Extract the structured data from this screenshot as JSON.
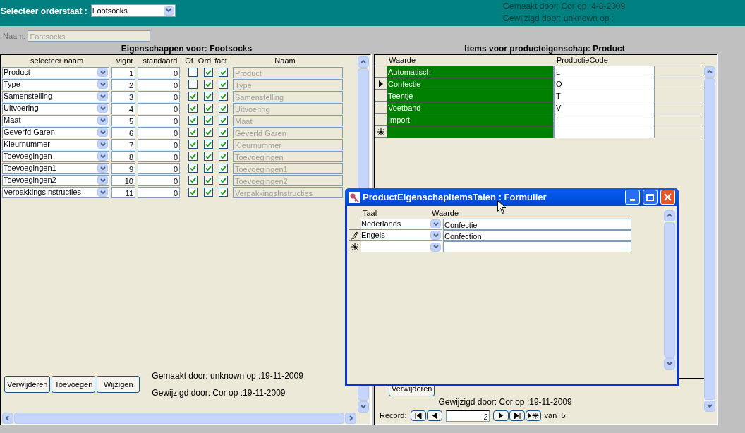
{
  "header": {
    "label": "Selecteer orderstaat :",
    "orderstaat": "Footsocks",
    "created": "Gemaakt door: Cor op :4-8-2009",
    "modified": "Gewijzigd door: unknown op :"
  },
  "name_field": {
    "label": "Naam:",
    "value": "Footsocks",
    "disabled": true
  },
  "properties": {
    "title": "Eigenschappen voor: Footsocks",
    "columns": [
      "selecteer naam",
      "vlgnr",
      "standaard",
      "Of",
      "Ord",
      "fact",
      "Naam"
    ],
    "rows": [
      {
        "name": "Product",
        "vlgnr": "1",
        "standaard": "0",
        "of": false,
        "ord": true,
        "fact": true,
        "naam": "Product"
      },
      {
        "name": "Type",
        "vlgnr": "2",
        "standaard": "0",
        "of": false,
        "ord": true,
        "fact": true,
        "naam": "Type"
      },
      {
        "name": "Samenstelling",
        "vlgnr": "3",
        "standaard": "0",
        "of": true,
        "ord": true,
        "fact": true,
        "naam": "Samenstelling"
      },
      {
        "name": "Uitvoering",
        "vlgnr": "4",
        "standaard": "0",
        "of": true,
        "ord": true,
        "fact": true,
        "naam": "Uitvoering"
      },
      {
        "name": "Maat",
        "vlgnr": "5",
        "standaard": "0",
        "of": true,
        "ord": true,
        "fact": true,
        "naam": "Maat"
      },
      {
        "name": "Geverfd Garen",
        "vlgnr": "6",
        "standaard": "0",
        "of": true,
        "ord": true,
        "fact": true,
        "naam": "Geverfd Garen"
      },
      {
        "name": "Kleurnummer",
        "vlgnr": "7",
        "standaard": "0",
        "of": true,
        "ord": true,
        "fact": true,
        "naam": "Kleurnummer"
      },
      {
        "name": "Toevoegingen",
        "vlgnr": "8",
        "standaard": "0",
        "of": true,
        "ord": true,
        "fact": true,
        "naam": "Toevoegingen"
      },
      {
        "name": "Toevoegingen1",
        "vlgnr": "9",
        "standaard": "0",
        "of": true,
        "ord": true,
        "fact": true,
        "naam": "Toevoegingen1"
      },
      {
        "name": "Toevoegingen2",
        "vlgnr": "10",
        "standaard": "0",
        "of": true,
        "ord": true,
        "fact": true,
        "naam": "Toevoegingen2"
      },
      {
        "name": "VerpakkingsInstructies",
        "vlgnr": "11",
        "standaard": "0",
        "of": true,
        "ord": true,
        "fact": true,
        "naam": "VerpakkingsInstructies"
      }
    ],
    "buttons": [
      "Verwijderen",
      "Toevoegen",
      "Wijzigen"
    ],
    "created": "Gemaakt door: unknown op :19-11-2009",
    "modified": "Gewijzigd door: Cor op :19-11-2009"
  },
  "items": {
    "title": "Items voor producteigenschap: Product",
    "columns": [
      "Waarde",
      "ProductieCode"
    ],
    "rows": [
      {
        "waarde": "Automatisch",
        "code": "L",
        "selected": false
      },
      {
        "waarde": "Confectie",
        "code": "O",
        "selected": true
      },
      {
        "waarde": "Teentje",
        "code": "T",
        "selected": false
      },
      {
        "waarde": "Voetband",
        "code": "V",
        "selected": false
      },
      {
        "waarde": "Import",
        "code": "I",
        "selected": false
      }
    ],
    "button": "Verwijderen",
    "modified": "Gewijzigd door: Cor op :19-11-2009",
    "record": {
      "label": "Record:",
      "current": "2",
      "total": "van  5"
    }
  },
  "dialog": {
    "title": "ProductEigenschapItemsTalen : Formulier",
    "columns": [
      "Taal",
      "Waarde"
    ],
    "rows": [
      {
        "taal": "Nederlands",
        "waarde": "Confectie",
        "editing": false
      },
      {
        "taal": "Engels",
        "waarde": "Confection",
        "editing": true
      }
    ]
  }
}
